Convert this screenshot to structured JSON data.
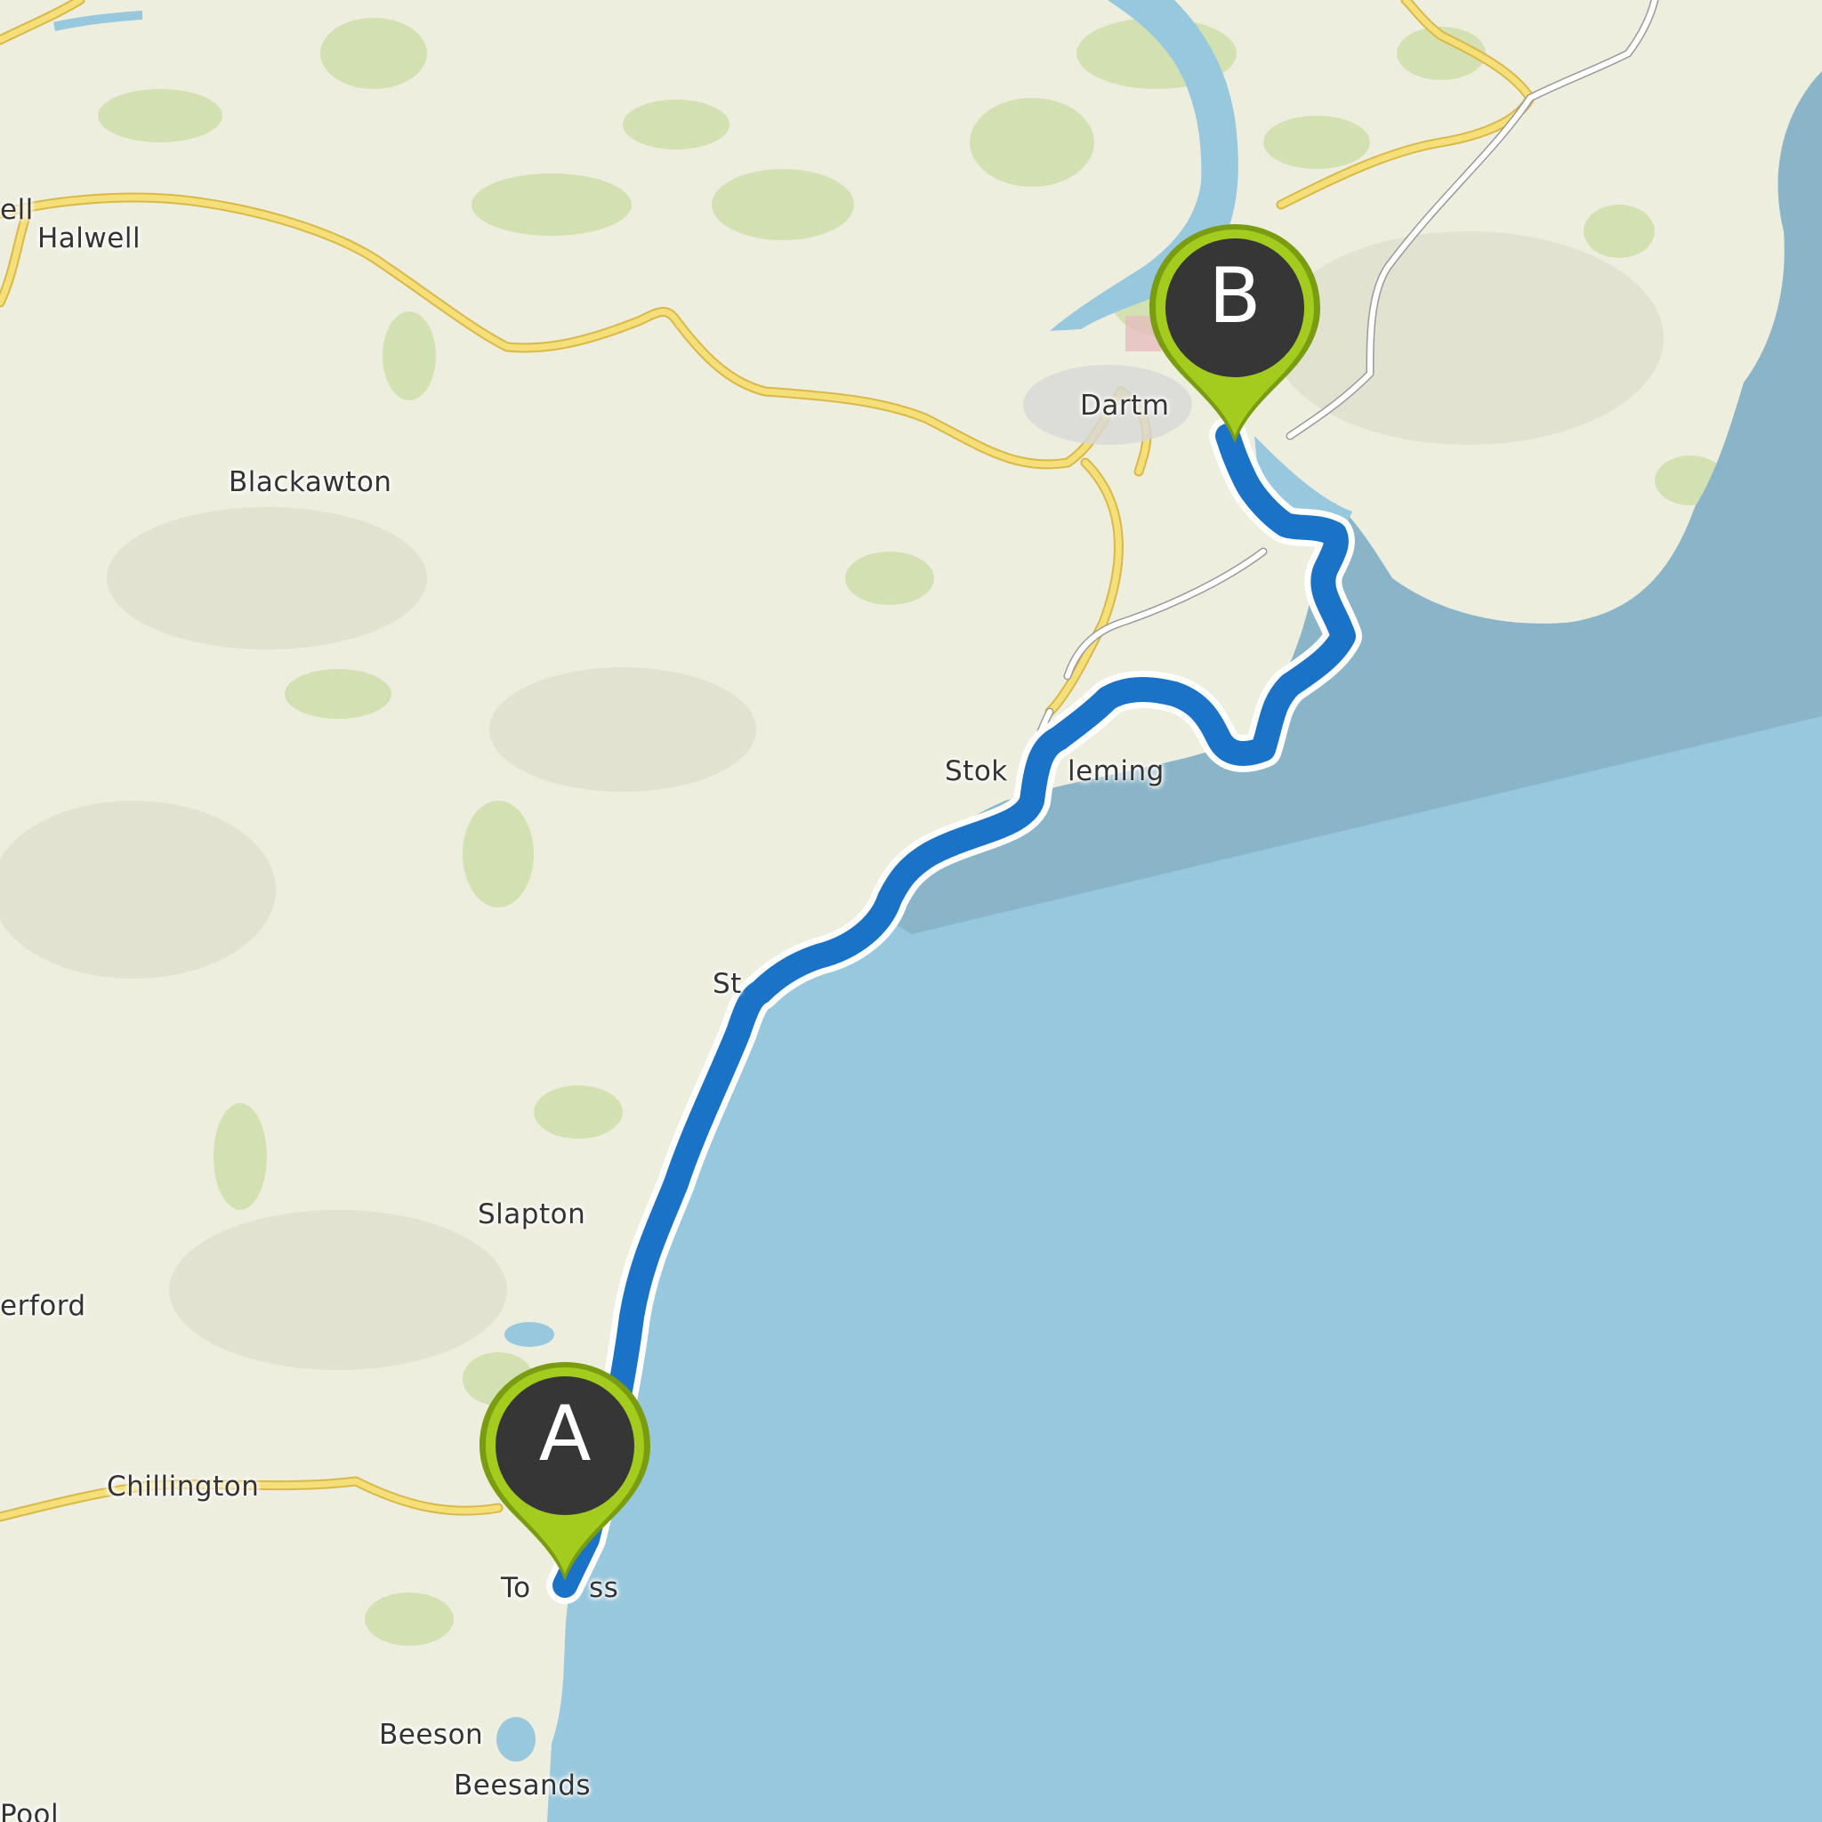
{
  "map": {
    "colors": {
      "land": "#eeeedf",
      "sea": "#97c8dd",
      "sea_zone": "#8ab5c9",
      "woodland": "#c9dca3",
      "major_road": "#f5df79",
      "minor_road": "#ffffff",
      "route": "#1a73c6",
      "marker_fill": "#99c21b",
      "marker_center": "#363636"
    },
    "route": {
      "name": "",
      "start_label": "A",
      "end_label": "B",
      "start_place": "Torcross",
      "end_place": "Dartmouth"
    },
    "places": [
      {
        "id": "halwell",
        "label": "Halwell"
      },
      {
        "id": "halwell-edge",
        "label": "ell"
      },
      {
        "id": "blackawton",
        "label": "Blackawton"
      },
      {
        "id": "dartmouth",
        "label": "Dartm"
      },
      {
        "id": "stoke-fleming-a",
        "label": "Stok"
      },
      {
        "id": "stoke-fleming-b",
        "label": "leming"
      },
      {
        "id": "strete",
        "label": "St"
      },
      {
        "id": "slapton",
        "label": "Slapton"
      },
      {
        "id": "frogmore-edge",
        "label": "erford"
      },
      {
        "id": "chillington",
        "label": "Chillington"
      },
      {
        "id": "torcross-a",
        "label": "To"
      },
      {
        "id": "torcross-b",
        "label": "ss"
      },
      {
        "id": "beeson",
        "label": "Beeson"
      },
      {
        "id": "beesands",
        "label": "Beesands"
      },
      {
        "id": "pool-edge",
        "label": "Pool"
      }
    ]
  }
}
